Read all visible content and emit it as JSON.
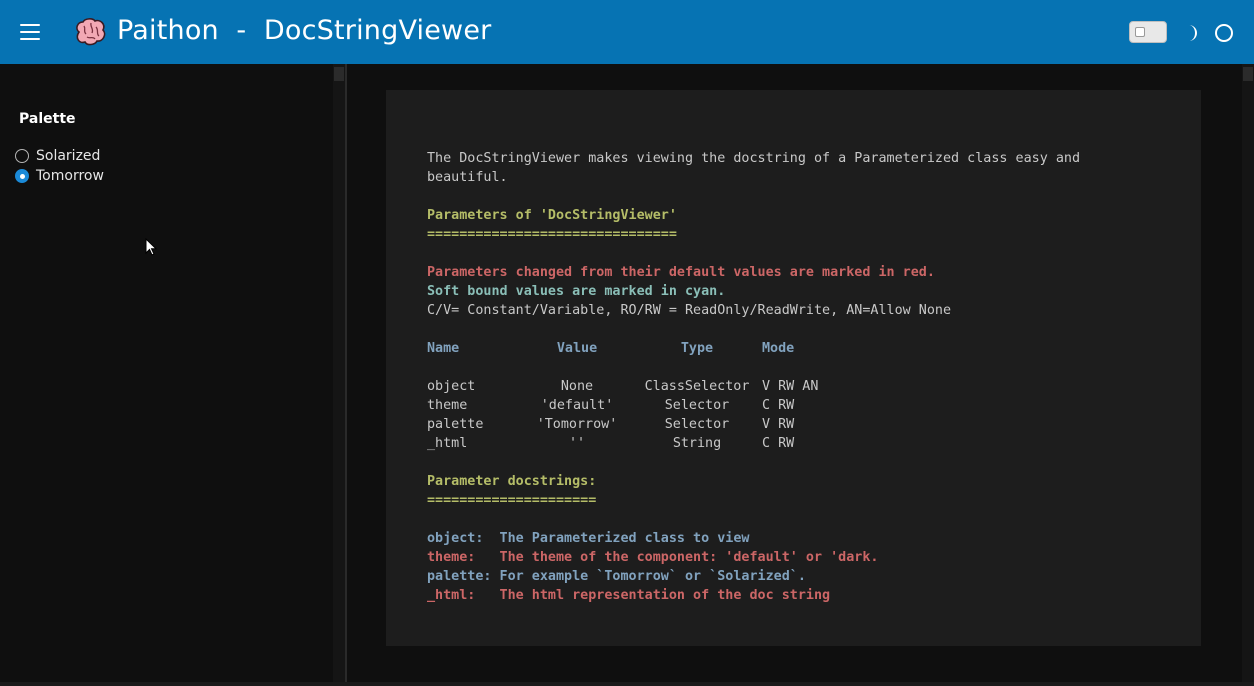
{
  "header": {
    "title": "Paithon  -  DocStringViewer",
    "bg_color": "#0673b3"
  },
  "icons": {
    "menu": "hamburger-icon",
    "logo": "brain-icon",
    "theme": "moon-icon",
    "busy": "circle-icon"
  },
  "sidebar": {
    "palette_label": "Palette",
    "options": [
      {
        "label": "Solarized",
        "checked": false
      },
      {
        "label": "Tomorrow",
        "checked": true
      }
    ]
  },
  "doc": {
    "intro1": "The DocStringViewer makes viewing the docstring of a Parameterized class easy and",
    "intro2": "beautiful.",
    "params_heading": "Parameters of 'DocStringViewer'",
    "params_underline": "===============================",
    "changed_note": "Parameters changed from their default values are marked in red.",
    "soft_note": "Soft bound values are marked in cyan.",
    "legend": "C/V= Constant/Variable, RO/RW = ReadOnly/ReadWrite, AN=Allow None",
    "columns": [
      "Name",
      "Value",
      "Type",
      "Mode"
    ],
    "rows": [
      {
        "name": "object",
        "value": "None",
        "type": "ClassSelector",
        "mode": "V RW AN"
      },
      {
        "name": "theme",
        "value": "'default'",
        "type": "Selector",
        "mode": "C RW"
      },
      {
        "name": "palette",
        "value": "'Tomorrow'",
        "type": "Selector",
        "mode": "V RW"
      },
      {
        "name": "_html",
        "value": "''",
        "type": "String",
        "mode": "C RW"
      }
    ],
    "docstrings_heading": "Parameter docstrings:",
    "docstrings_underline": "=====================",
    "docstrings": [
      {
        "text": "object:  The Parameterized class to view",
        "style": "blue"
      },
      {
        "text": "theme:   The theme of the component: 'default' or 'dark.",
        "style": "red"
      },
      {
        "text": "palette: For example `Tomorrow` or `Solarized`.",
        "style": "blue"
      },
      {
        "text": "_html:   The html representation of the doc string",
        "style": "red"
      }
    ]
  }
}
